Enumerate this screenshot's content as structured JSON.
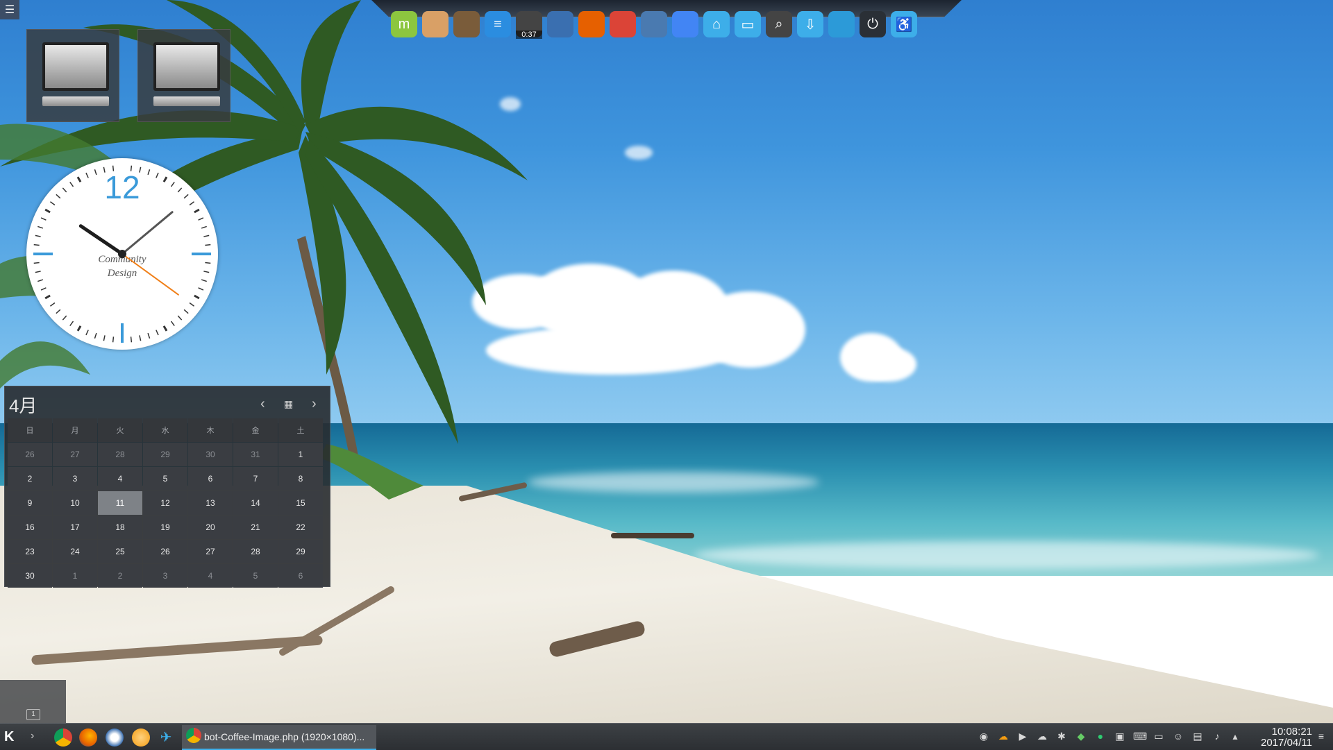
{
  "dock": {
    "icons": [
      {
        "name": "mint-menu",
        "glyph": "m",
        "color": "#8cc63f"
      },
      {
        "name": "archive",
        "glyph": "",
        "color": "#d9a066"
      },
      {
        "name": "brush",
        "glyph": "",
        "color": "#7a5c3a"
      },
      {
        "name": "text-editor",
        "glyph": "≡",
        "color": "#2b8de0"
      },
      {
        "name": "screenshot",
        "glyph": "",
        "color": "#444",
        "badge": "0:37"
      },
      {
        "name": "thunderbird",
        "glyph": "",
        "color": "#3a6fb0"
      },
      {
        "name": "firefox",
        "glyph": "",
        "color": "#e66000"
      },
      {
        "name": "chrome",
        "glyph": "",
        "color": "#db4437"
      },
      {
        "name": "system-settings",
        "glyph": "",
        "color": "#4a7ab0"
      },
      {
        "name": "chromium",
        "glyph": "",
        "color": "#4285f4"
      },
      {
        "name": "home-folder",
        "glyph": "⌂",
        "color": "#3daee9"
      },
      {
        "name": "documents-folder",
        "glyph": "▭",
        "color": "#3daee9"
      },
      {
        "name": "search",
        "glyph": "⌕",
        "color": "#444"
      },
      {
        "name": "downloads-folder",
        "glyph": "⇩",
        "color": "#3daee9"
      },
      {
        "name": "kde-plasma",
        "glyph": "",
        "color": "#2c9ad8"
      },
      {
        "name": "power",
        "glyph": "⏻",
        "color": "#2a2f36"
      },
      {
        "name": "accessibility",
        "glyph": "♿",
        "color": "#3daee9"
      }
    ]
  },
  "clock": {
    "numeral": "12",
    "brand_line1": "Community",
    "brand_line2": "Design"
  },
  "calendar": {
    "month": "4月",
    "weekdays": [
      "日",
      "月",
      "火",
      "水",
      "木",
      "金",
      "土"
    ],
    "weeks": [
      [
        "26",
        "27",
        "28",
        "29",
        "30",
        "31",
        "1"
      ],
      [
        "2",
        "3",
        "4",
        "5",
        "6",
        "7",
        "8"
      ],
      [
        "9",
        "10",
        "11",
        "12",
        "13",
        "14",
        "15"
      ],
      [
        "16",
        "17",
        "18",
        "19",
        "20",
        "21",
        "22"
      ],
      [
        "23",
        "24",
        "25",
        "26",
        "27",
        "28",
        "29"
      ],
      [
        "30",
        "1",
        "2",
        "3",
        "4",
        "5",
        "6"
      ]
    ],
    "today": "11"
  },
  "pager": {
    "current": "1"
  },
  "taskbar": {
    "task_title": "bot-Coffee-Image.php (1920×1080)...",
    "time": "10:08:21",
    "date": "2017/04/11"
  }
}
